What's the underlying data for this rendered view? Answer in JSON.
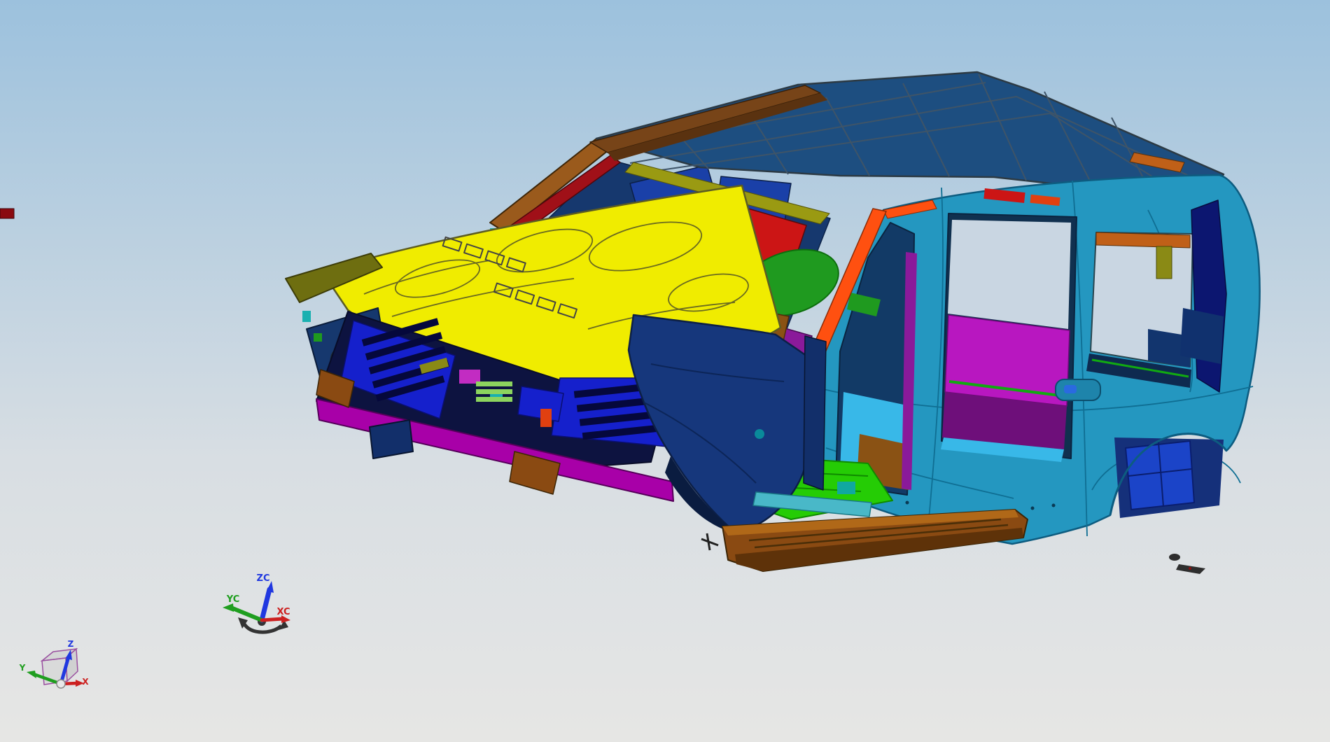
{
  "app": {
    "name": "cad-3d-viewport",
    "content": "body-in-white car model"
  },
  "viewport": {
    "bg_top": "#9cc1dd",
    "bg_mid": "#d8dee3",
    "bg_bottom": "#e6e6e4",
    "window": "#c9d6e2"
  },
  "wcs_triad": {
    "label_z": "ZC",
    "label_y": "YC",
    "label_x": "XC",
    "color_z": "#2038e0",
    "color_y": "#1f9e1f",
    "color_x": "#cc2020",
    "base_color": "#333333"
  },
  "abs_triad": {
    "label_z": "Z",
    "label_y": "Y",
    "label_x": "X",
    "color_z": "#2038e0",
    "color_y": "#1f9e1f",
    "color_x": "#cc2020",
    "cube_edge_color": "#9a50a0"
  },
  "model": {
    "palette": {
      "edge": "#2e3a42",
      "roof": "#1d4e80",
      "roof_line": "#3e5468",
      "header_brown": "#774418",
      "header_brown_dark": "#5a3210",
      "header_olive": "#9a9a12",
      "hood_yellow": "#f0ec00",
      "hood_line": "#5c5c22",
      "apillar_brown": "#9a5a1c",
      "red_inner": "#a01018",
      "red_bright": "#cc1515",
      "red_dark": "#8a0a10",
      "magenta": "#c22cc2",
      "purple": "#8a1a9a",
      "green": "#1f9a1f",
      "green_dark": "#0d6e0d",
      "green_floor": "#25cc05",
      "green_light": "#8cd45e",
      "orange": "#ff5010",
      "orange_deep": "#c06018",
      "orange_accent": "#e04010",
      "navy_interior": "#16386e",
      "blue_panel": "#1a40a8",
      "navy_deep": "#0d1340",
      "blue_radiator": "#1520cc",
      "blue_radiator_dark": "#0e17a0",
      "magenta_bumper": "#a800a8",
      "brown_copper": "#8a5214",
      "cyan_body": "#2497c0",
      "cyan_line": "#0f6e93",
      "navy_fender": "#16377c",
      "navy_fender_dark": "#0a1c40",
      "navy_hinge": "#122f6a",
      "teal_sill": "#49b8c8",
      "cyan_floor": "#38b8e8",
      "brown_rocker": "#8a4a12",
      "brown_rocker_dark": "#5e3209",
      "brown_rocker_light": "#b06818",
      "magenta_seat": "#b817c0",
      "purple_seat": "#6e0f7a",
      "navy_dpillar": "#0c1670",
      "blue_arch": "#1b44c8",
      "navy_arch": "#15307a",
      "olive": "#6e6e10",
      "olive_bracket": "#8a8a15",
      "teal_accent": "#19b0b0",
      "gray_light": "#d8d8d8",
      "dark_part": "#2e2e2e"
    }
  }
}
